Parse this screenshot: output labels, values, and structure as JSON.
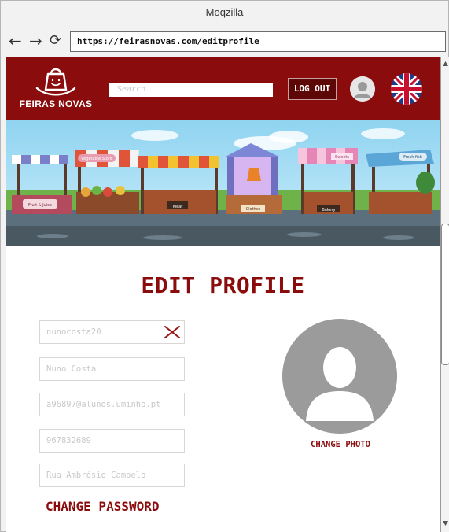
{
  "window": {
    "title": "Moqzilla"
  },
  "browser": {
    "back_icon": "←",
    "forward_icon": "→",
    "reload_icon": "⟳",
    "url": "https://feirasnovas.com/editprofile"
  },
  "header": {
    "brand": "FEIRAS NOVAS",
    "search_placeholder": "Search",
    "logout_label": "LOG OUT",
    "language": "uk-flag-icon"
  },
  "page": {
    "title": "EDIT PROFILE",
    "fields": {
      "username": "nunocosta20",
      "name": "Nuno Costa",
      "email": "a96897@alunos.uminho.pt",
      "phone": "967832689",
      "address": "Rua Ambrósio Campelo"
    },
    "change_password_label": "CHANGE PASSWORD",
    "change_photo_label": "CHANGE PHOTO"
  },
  "banner_signs": [
    "Vegetable Store",
    "Sweets",
    "Fresh fish",
    "Meat",
    "Clothes",
    "Bakery",
    "Fruit & Juice"
  ],
  "colors": {
    "brand": "#8a0c0c",
    "brand_dark": "#5e0707",
    "header_bg": "#8a0c0c"
  }
}
